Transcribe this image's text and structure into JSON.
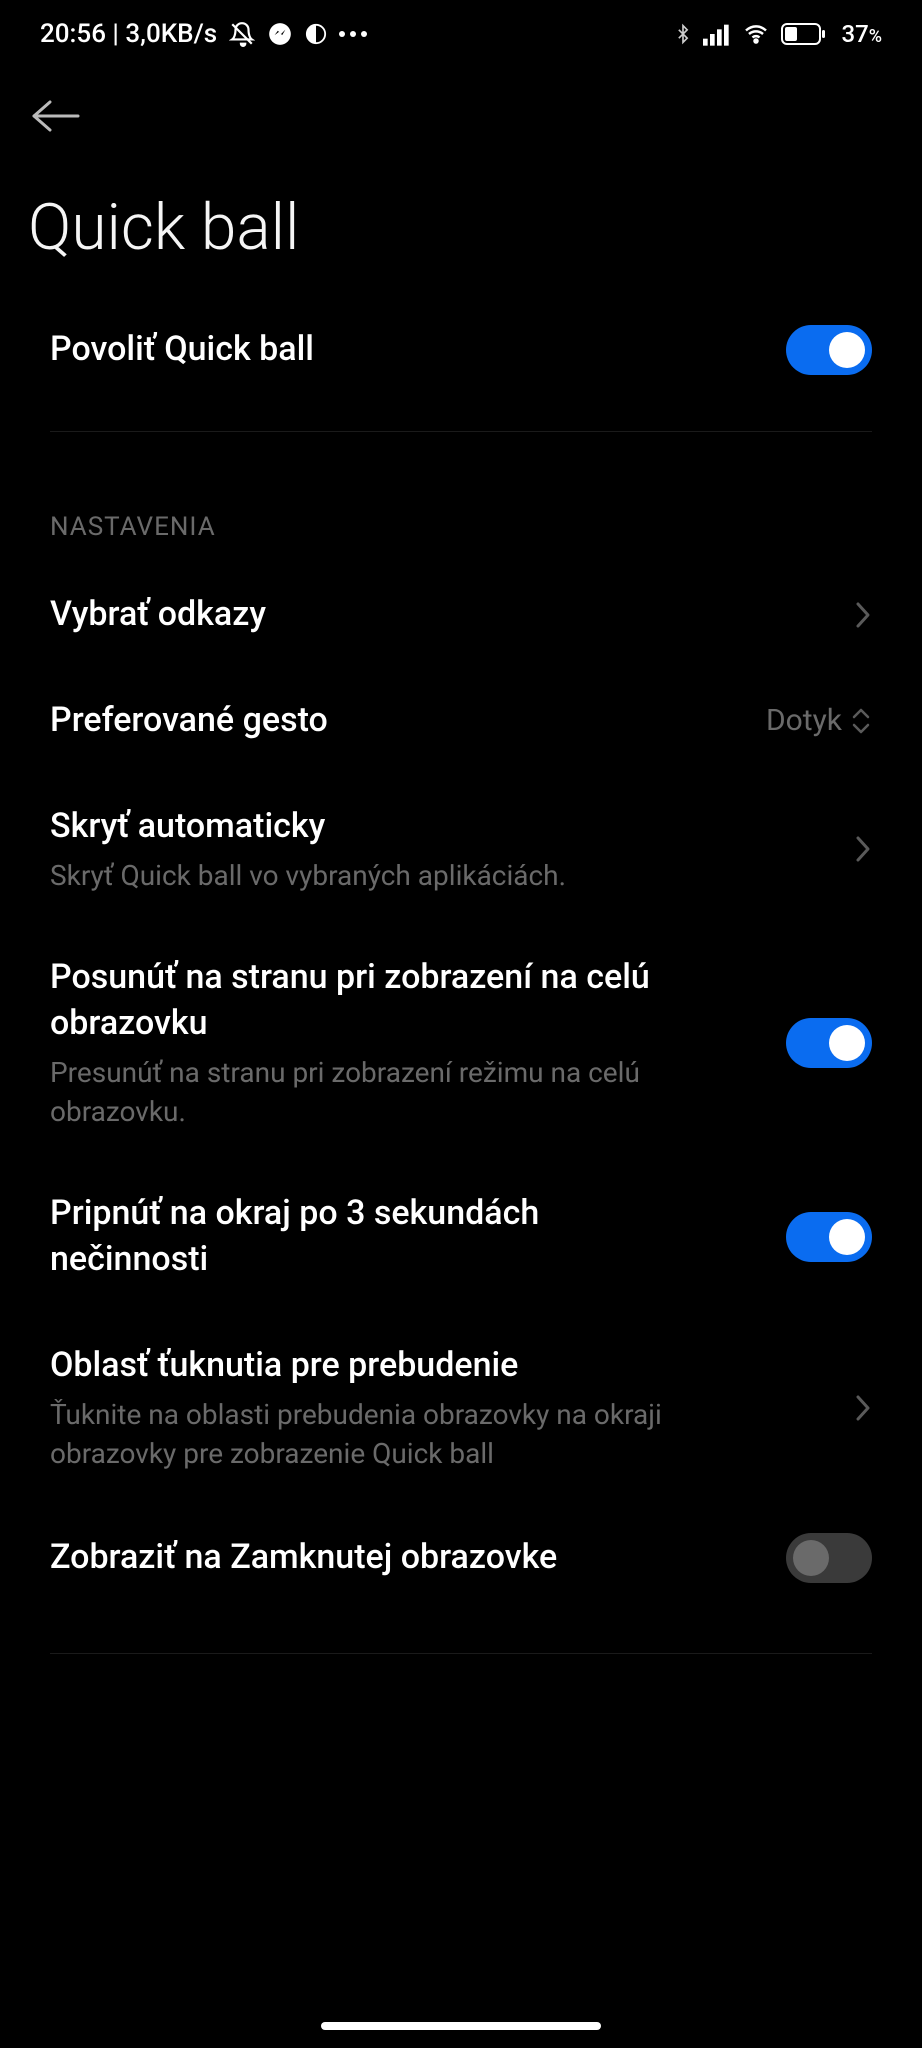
{
  "statusBar": {
    "time": "20:56",
    "speed": "3,0KB/s",
    "battery": "37"
  },
  "header": {
    "title": "Quick ball"
  },
  "settings": {
    "enableQuickBall": {
      "title": "Povoliť Quick ball"
    },
    "sectionLabel": "NASTAVENIA",
    "selectLinks": {
      "title": "Vybrať odkazy"
    },
    "preferredGesture": {
      "title": "Preferované gesto",
      "value": "Dotyk"
    },
    "hideAuto": {
      "title": "Skryť automaticky",
      "sub": "Skryť Quick ball vo vybraných aplikáciách."
    },
    "moveFullscreen": {
      "title": "Posunúť na stranu pri zobrazení na celú obrazovku",
      "sub": "Presunúť na stranu pri zobrazení režimu na celú obrazovku."
    },
    "pinEdge": {
      "title": "Pripnúť na okraj po 3 sekundách nečinnosti"
    },
    "tapAreaWake": {
      "title": "Oblasť ťuknutia pre prebudenie",
      "sub": "Ťuknite na oblasti prebudenia obrazovky na okraji obrazovky pre zobrazenie Quick ball"
    },
    "showLock": {
      "title": "Zobraziť na Zamknutej obrazovke"
    }
  }
}
